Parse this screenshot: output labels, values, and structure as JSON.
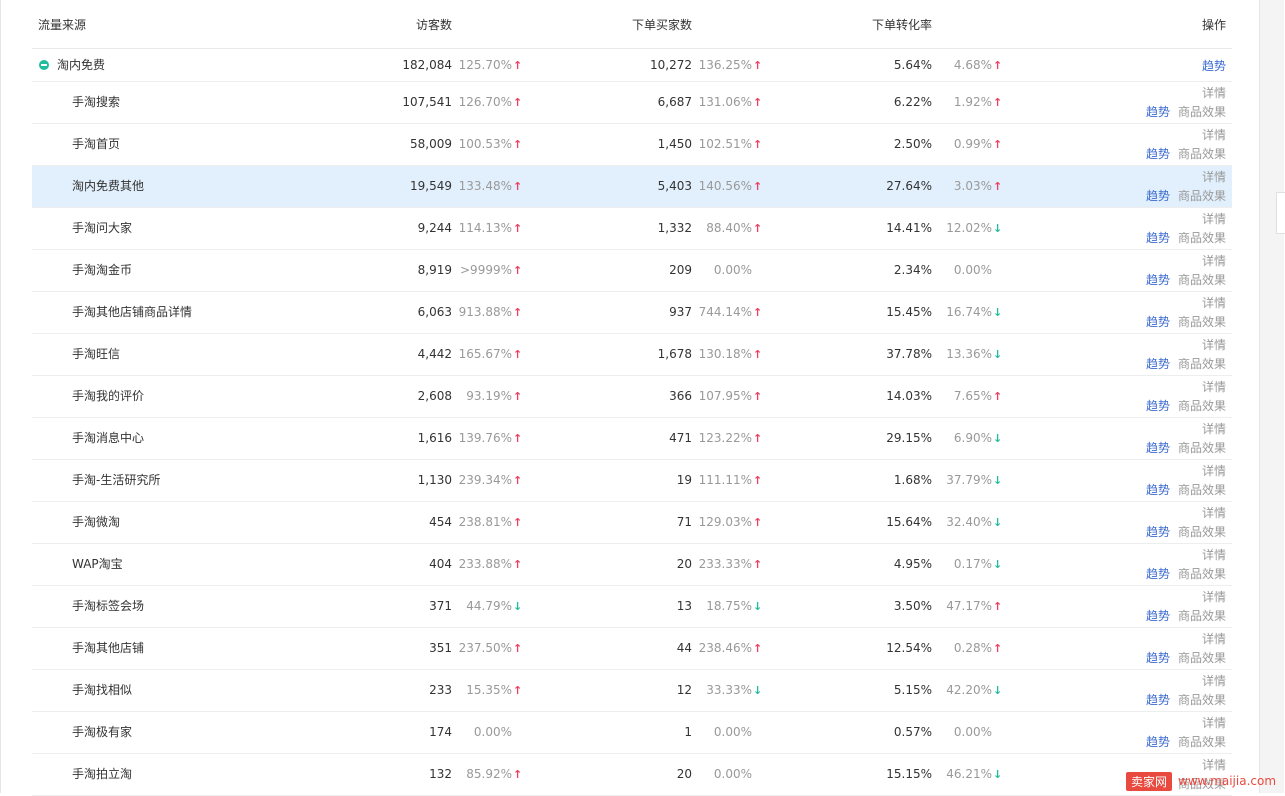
{
  "header": {
    "source": "流量来源",
    "visitors": "访客数",
    "buyers": "下单买家数",
    "conversion": "下单转化率",
    "actions": "操作"
  },
  "parent_row": {
    "name": "淘内免费",
    "visitors": "182,084",
    "visitors_change": "125.70%",
    "visitors_dir": "up",
    "buyers": "10,272",
    "buyers_change": "136.25%",
    "buyers_dir": "up",
    "conversion": "5.64%",
    "conversion_change": "4.68%",
    "conversion_dir": "up",
    "trend_label": "趋势"
  },
  "action_labels": {
    "detail": "详情",
    "trend": "趋势",
    "effect": "商品效果"
  },
  "rows": [
    {
      "name": "手淘搜索",
      "visitors": "107,541",
      "visitors_change": "126.70%",
      "visitors_dir": "up",
      "buyers": "6,687",
      "buyers_change": "131.06%",
      "buyers_dir": "up",
      "conversion": "6.22%",
      "conversion_change": "1.92%",
      "conversion_dir": "up"
    },
    {
      "name": "手淘首页",
      "visitors": "58,009",
      "visitors_change": "100.53%",
      "visitors_dir": "up",
      "buyers": "1,450",
      "buyers_change": "102.51%",
      "buyers_dir": "up",
      "conversion": "2.50%",
      "conversion_change": "0.99%",
      "conversion_dir": "up"
    },
    {
      "name": "淘内免费其他",
      "visitors": "19,549",
      "visitors_change": "133.48%",
      "visitors_dir": "up",
      "buyers": "5,403",
      "buyers_change": "140.56%",
      "buyers_dir": "up",
      "conversion": "27.64%",
      "conversion_change": "3.03%",
      "conversion_dir": "up",
      "highlighted": true
    },
    {
      "name": "手淘问大家",
      "visitors": "9,244",
      "visitors_change": "114.13%",
      "visitors_dir": "up",
      "buyers": "1,332",
      "buyers_change": "88.40%",
      "buyers_dir": "up",
      "conversion": "14.41%",
      "conversion_change": "12.02%",
      "conversion_dir": "down"
    },
    {
      "name": "手淘淘金币",
      "visitors": "8,919",
      "visitors_change": ">9999%",
      "visitors_dir": "up",
      "buyers": "209",
      "buyers_change": "0.00%",
      "buyers_dir": "none",
      "conversion": "2.34%",
      "conversion_change": "0.00%",
      "conversion_dir": "none"
    },
    {
      "name": "手淘其他店铺商品详情",
      "visitors": "6,063",
      "visitors_change": "913.88%",
      "visitors_dir": "up",
      "buyers": "937",
      "buyers_change": "744.14%",
      "buyers_dir": "up",
      "conversion": "15.45%",
      "conversion_change": "16.74%",
      "conversion_dir": "down"
    },
    {
      "name": "手淘旺信",
      "visitors": "4,442",
      "visitors_change": "165.67%",
      "visitors_dir": "up",
      "buyers": "1,678",
      "buyers_change": "130.18%",
      "buyers_dir": "up",
      "conversion": "37.78%",
      "conversion_change": "13.36%",
      "conversion_dir": "down"
    },
    {
      "name": "手淘我的评价",
      "visitors": "2,608",
      "visitors_change": "93.19%",
      "visitors_dir": "up",
      "buyers": "366",
      "buyers_change": "107.95%",
      "buyers_dir": "up",
      "conversion": "14.03%",
      "conversion_change": "7.65%",
      "conversion_dir": "up"
    },
    {
      "name": "手淘消息中心",
      "visitors": "1,616",
      "visitors_change": "139.76%",
      "visitors_dir": "up",
      "buyers": "471",
      "buyers_change": "123.22%",
      "buyers_dir": "up",
      "conversion": "29.15%",
      "conversion_change": "6.90%",
      "conversion_dir": "down"
    },
    {
      "name": "手淘-生活研究所",
      "visitors": "1,130",
      "visitors_change": "239.34%",
      "visitors_dir": "up",
      "buyers": "19",
      "buyers_change": "111.11%",
      "buyers_dir": "up",
      "conversion": "1.68%",
      "conversion_change": "37.79%",
      "conversion_dir": "down"
    },
    {
      "name": "手淘微淘",
      "visitors": "454",
      "visitors_change": "238.81%",
      "visitors_dir": "up",
      "buyers": "71",
      "buyers_change": "129.03%",
      "buyers_dir": "up",
      "conversion": "15.64%",
      "conversion_change": "32.40%",
      "conversion_dir": "down"
    },
    {
      "name": "WAP淘宝",
      "visitors": "404",
      "visitors_change": "233.88%",
      "visitors_dir": "up",
      "buyers": "20",
      "buyers_change": "233.33%",
      "buyers_dir": "up",
      "conversion": "4.95%",
      "conversion_change": "0.17%",
      "conversion_dir": "down"
    },
    {
      "name": "手淘标签会场",
      "visitors": "371",
      "visitors_change": "44.79%",
      "visitors_dir": "down",
      "buyers": "13",
      "buyers_change": "18.75%",
      "buyers_dir": "down",
      "conversion": "3.50%",
      "conversion_change": "47.17%",
      "conversion_dir": "up"
    },
    {
      "name": "手淘其他店铺",
      "visitors": "351",
      "visitors_change": "237.50%",
      "visitors_dir": "up",
      "buyers": "44",
      "buyers_change": "238.46%",
      "buyers_dir": "up",
      "conversion": "12.54%",
      "conversion_change": "0.28%",
      "conversion_dir": "up"
    },
    {
      "name": "手淘找相似",
      "visitors": "233",
      "visitors_change": "15.35%",
      "visitors_dir": "up",
      "buyers": "12",
      "buyers_change": "33.33%",
      "buyers_dir": "down",
      "conversion": "5.15%",
      "conversion_change": "42.20%",
      "conversion_dir": "down"
    },
    {
      "name": "手淘极有家",
      "visitors": "174",
      "visitors_change": "0.00%",
      "visitors_dir": "none",
      "buyers": "1",
      "buyers_change": "0.00%",
      "buyers_dir": "none",
      "conversion": "0.57%",
      "conversion_change": "0.00%",
      "conversion_dir": "none"
    },
    {
      "name": "手淘拍立淘",
      "visitors": "132",
      "visitors_change": "85.92%",
      "visitors_dir": "up",
      "buyers": "20",
      "buyers_change": "0.00%",
      "buyers_dir": "none",
      "conversion": "15.15%",
      "conversion_change": "46.21%",
      "conversion_dir": "down"
    }
  ],
  "watermark": {
    "brand": "卖家网",
    "url": "www.maijia.com"
  },
  "colors": {
    "up": "#ee3f63",
    "down": "#1fbd9c",
    "link": "#3c6bd0",
    "highlight": "#e2f0fd"
  }
}
